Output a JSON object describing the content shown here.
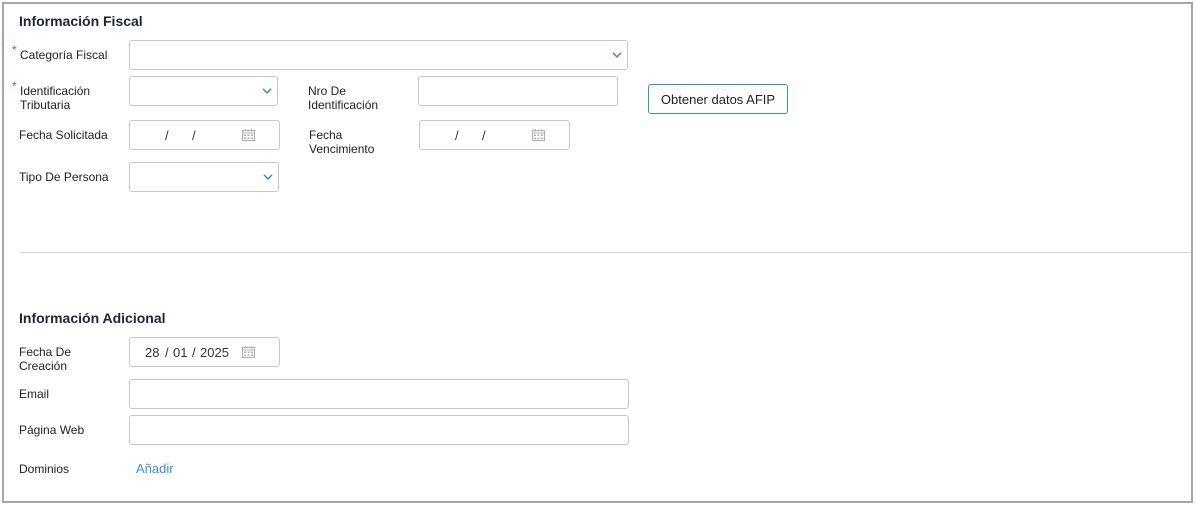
{
  "fiscal": {
    "title": "Información Fiscal",
    "required_mark": "*",
    "categoria_label": "Categoría Fiscal",
    "categoria_value": "",
    "identificacion_label_1": "Identificación",
    "identificacion_label_2": "Tributaria",
    "identificacion_value": "",
    "nro_label_1": "Nro De",
    "nro_label_2": "Identificación",
    "nro_value": "",
    "afip_button": "Obtener datos AFIP",
    "fecha_solicitada_label": "Fecha Solicitada",
    "fecha_solicitada": {
      "day": "",
      "month": "",
      "year": ""
    },
    "fecha_venc_label_1": "Fecha",
    "fecha_venc_label_2": "Vencimiento",
    "fecha_vencimiento": {
      "day": "",
      "month": "",
      "year": ""
    },
    "tipo_persona_label": "Tipo De Persona",
    "tipo_persona_value": ""
  },
  "adicional": {
    "title": "Información Adicional",
    "fecha_creacion_label_1": "Fecha De",
    "fecha_creacion_label_2": "Creación",
    "fecha_creacion": {
      "day": "28",
      "month": "01",
      "year": "2025"
    },
    "email_label": "Email",
    "email_value": "",
    "web_label": "Página Web",
    "web_value": "",
    "dominios_label": "Dominios",
    "anadir_link": "Añadir"
  },
  "date_separator": "/",
  "icons": {
    "select": "chevron-down-icon",
    "date": "calendar-icon"
  },
  "colors": {
    "accent": "#2a9cb8",
    "link": "#3a8fd6",
    "required": "#e03a3a"
  }
}
